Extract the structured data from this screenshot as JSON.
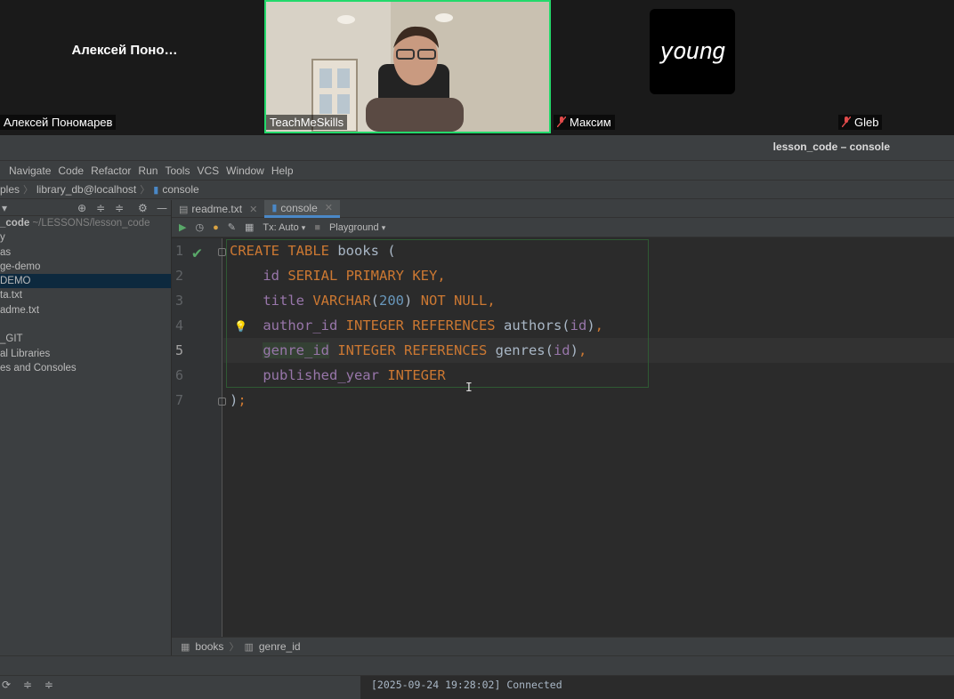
{
  "call": {
    "tiles": [
      {
        "center_name": "Алексей  Поно…",
        "label": "Алексей Пономарев"
      },
      {
        "label": "TeachMeSkills"
      },
      {
        "label": "Максим",
        "muted": true,
        "logo_text": "young"
      },
      {
        "label": "Gleb",
        "muted": true
      }
    ]
  },
  "ide": {
    "window_title": "lesson_code – console",
    "menu": [
      "Navigate",
      "Code",
      "Refactor",
      "Run",
      "Tools",
      "VCS",
      "Window",
      "Help"
    ],
    "breadcrumb": [
      "ples",
      "library_db@localhost",
      "console"
    ],
    "project": {
      "root_label": "_code",
      "root_path": "~/LESSONS/lesson_code",
      "items": [
        "y",
        "as",
        "ge-demo",
        "DEMO",
        "ta.txt",
        "adme.txt",
        "",
        "_GIT",
        "al Libraries",
        "es and Consoles"
      ],
      "selected_index": 3
    },
    "tabs": [
      {
        "label": "readme.txt",
        "active": false
      },
      {
        "label": "console",
        "active": true
      }
    ],
    "toolbar": {
      "tx_mode": "Tx: Auto",
      "playground": "Playground"
    },
    "code": {
      "line_numbers": [
        "1",
        "2",
        "3",
        "4",
        "5",
        "6",
        "7"
      ],
      "current_line": 5
    },
    "editor_breadcrumb": [
      "books",
      "genre_id"
    ],
    "console": {
      "line1": "[2025-09-24 19:28:02] Connected"
    },
    "colors": {
      "keyword": "#cc7832",
      "number": "#6897bb",
      "field": "#9876aa",
      "text": "#a9b7c6",
      "speaker_border": "#23d96b"
    }
  }
}
